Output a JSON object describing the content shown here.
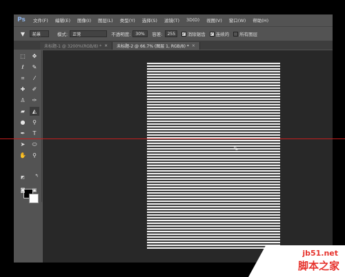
{
  "app": {
    "logo": "Ps"
  },
  "menu": [
    "文件(F)",
    "编辑(E)",
    "图像(I)",
    "图层(L)",
    "类型(Y)",
    "选择(S)",
    "滤镜(T)",
    "3D(D)",
    "视图(V)",
    "窗口(W)",
    "帮助(H)"
  ],
  "options": {
    "tool_icon": "paint-bucket-icon",
    "fill_source": "前景",
    "mode_label": "模式:",
    "mode_value": "正常",
    "opacity_label": "不透明度:",
    "opacity_value": "30%",
    "tolerance_label": "容差:",
    "tolerance_value": "255",
    "antialias_label": "消除锯齿",
    "contiguous_label": "连续的",
    "all_layers_label": "所有图层"
  },
  "tabs": [
    {
      "label": "未标题-1 @ 3200%(RGB/8) *",
      "active": false
    },
    {
      "label": "未标题-2 @ 66.7% (图层 1, RGB/8) *",
      "active": true
    }
  ],
  "colors": {
    "foreground": "#000000",
    "background": "#ffffff",
    "guide": "#c41e1e",
    "workspace": "#282828"
  },
  "watermark": {
    "url": "jb51.net",
    "name": "脚本之家"
  }
}
